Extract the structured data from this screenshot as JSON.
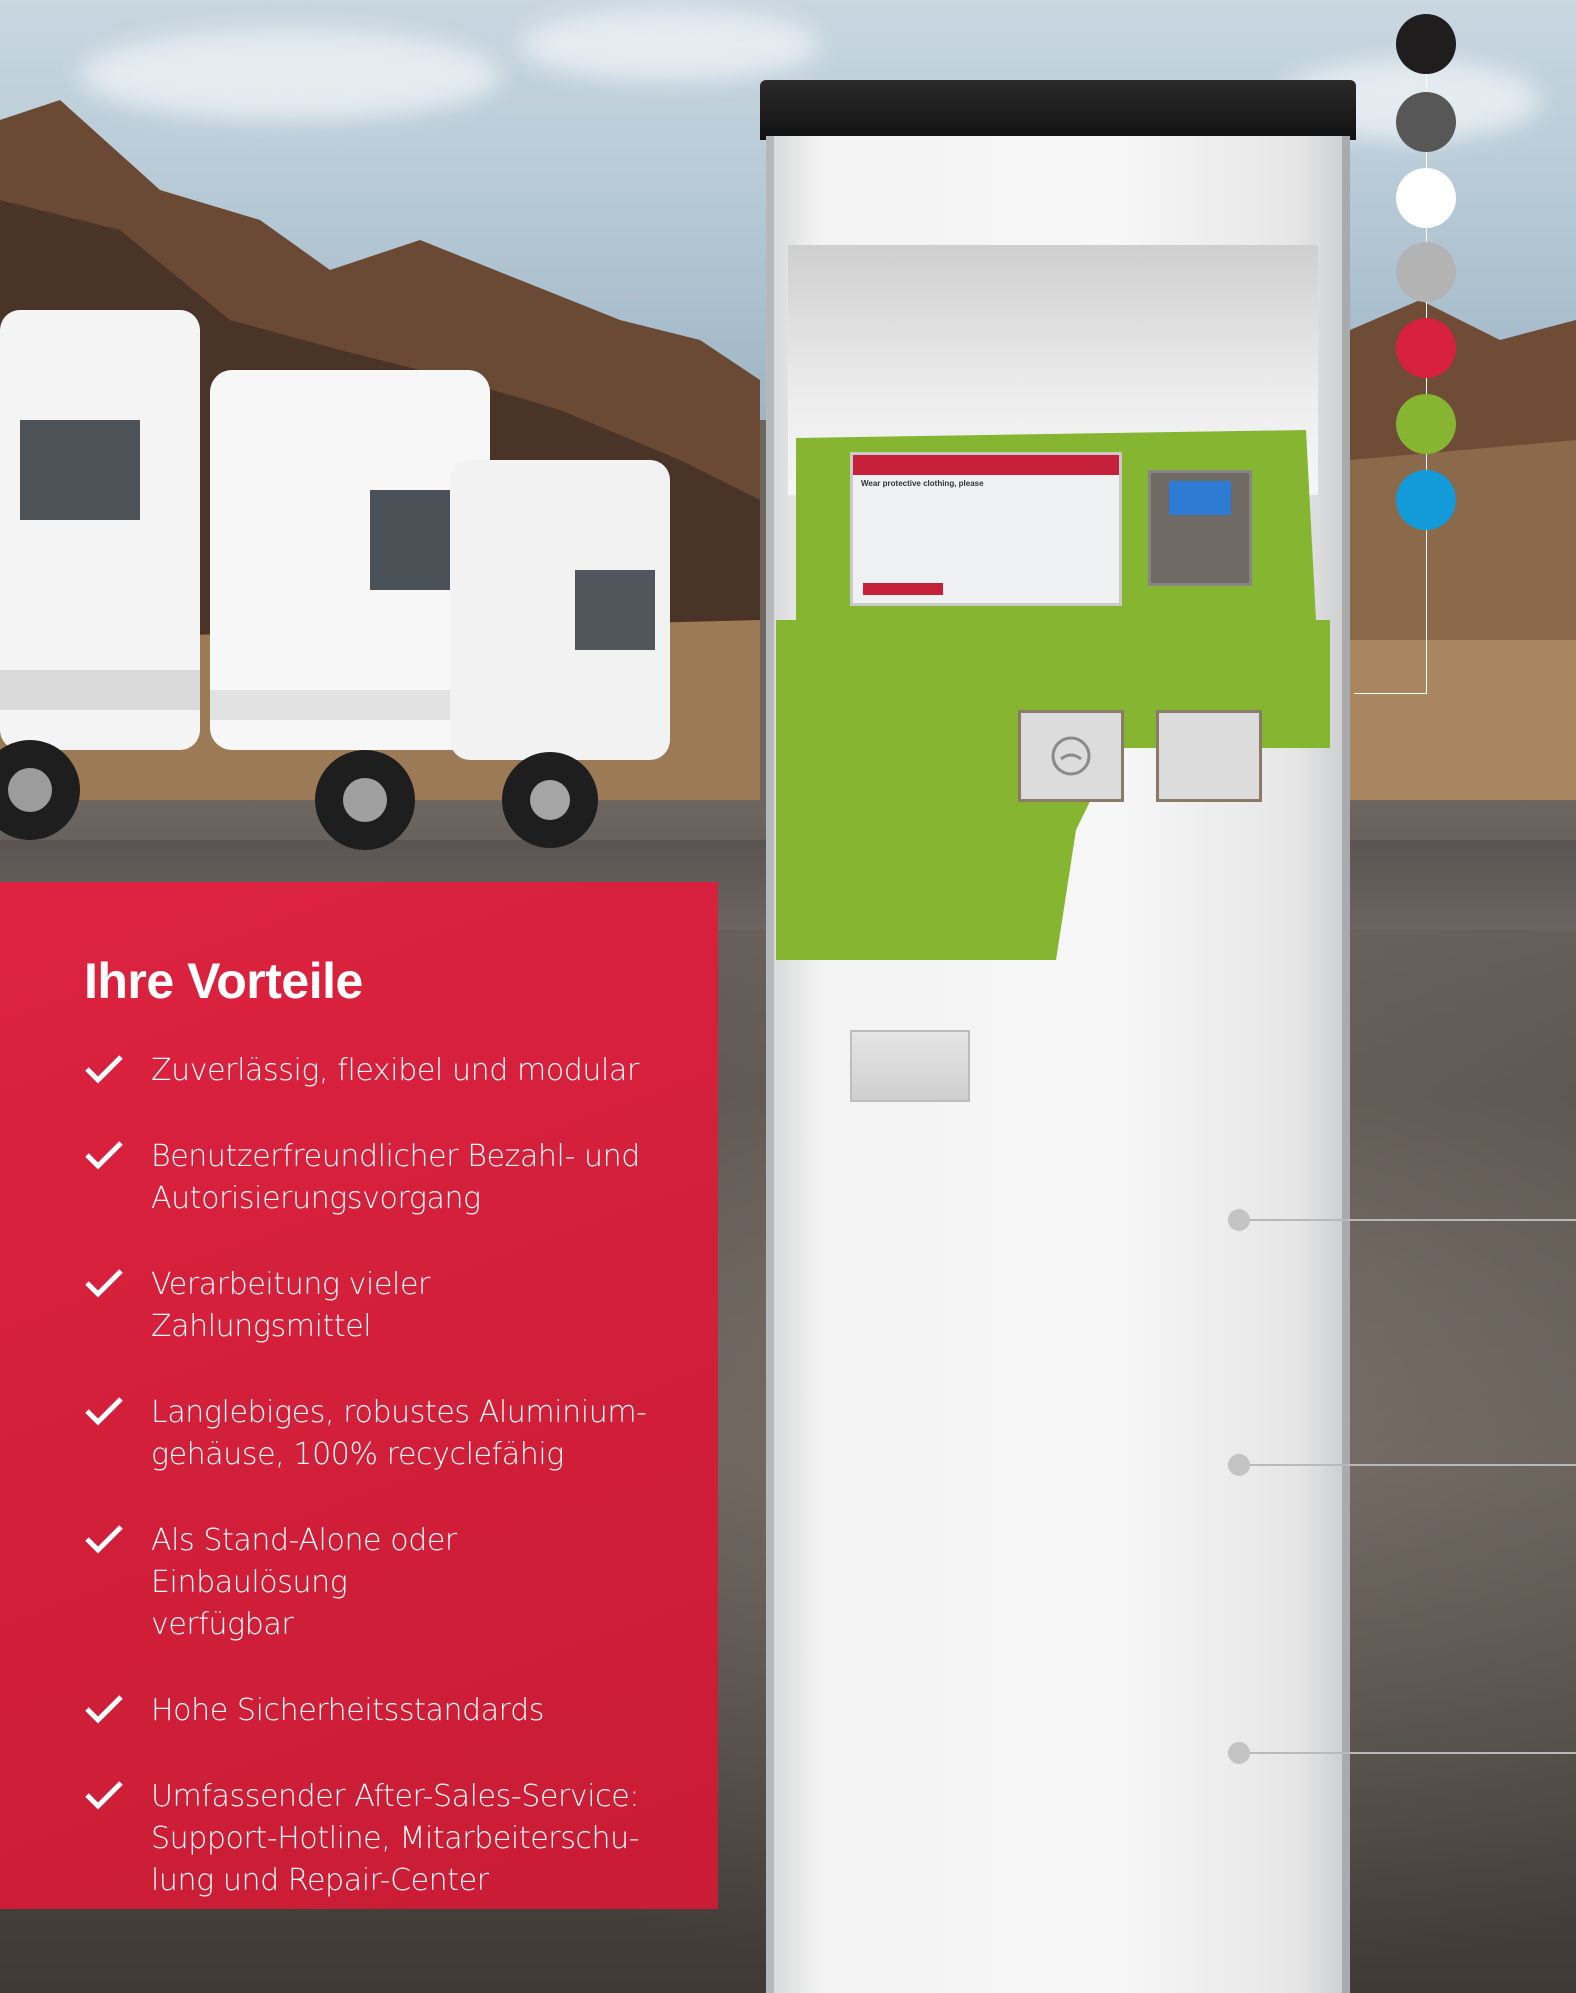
{
  "benefits": {
    "title": "Ihre Vorteile",
    "items": [
      "Zuverlässig, flexibel und modular",
      "Benutzerfreundlicher Bezahl- und\nAutorisierungsvorgang",
      "Verarbeitung vieler Zahlungsmittel",
      "Langlebiges, robustes Aluminium-\ngehäuse, 100% recyclefähig",
      "Als Stand-Alone oder Einbaulösung\nverfügbar",
      "Hohe Sicherheitsstandards",
      "Umfassender After-Sales-Service:\nSupport-Hotline, Mitarbeiterschu-\nlung und Repair-Center"
    ]
  },
  "colors": {
    "accent_red": "#d7213d",
    "panel_green": "#86b532",
    "swatches": [
      "#1f1d1e",
      "#575757",
      "#ffffff",
      "#b3b3b4",
      "#d7213d",
      "#86b532",
      "#129bd8"
    ]
  },
  "kiosk_screen": {
    "heading": "Wear protective clothing, please"
  }
}
